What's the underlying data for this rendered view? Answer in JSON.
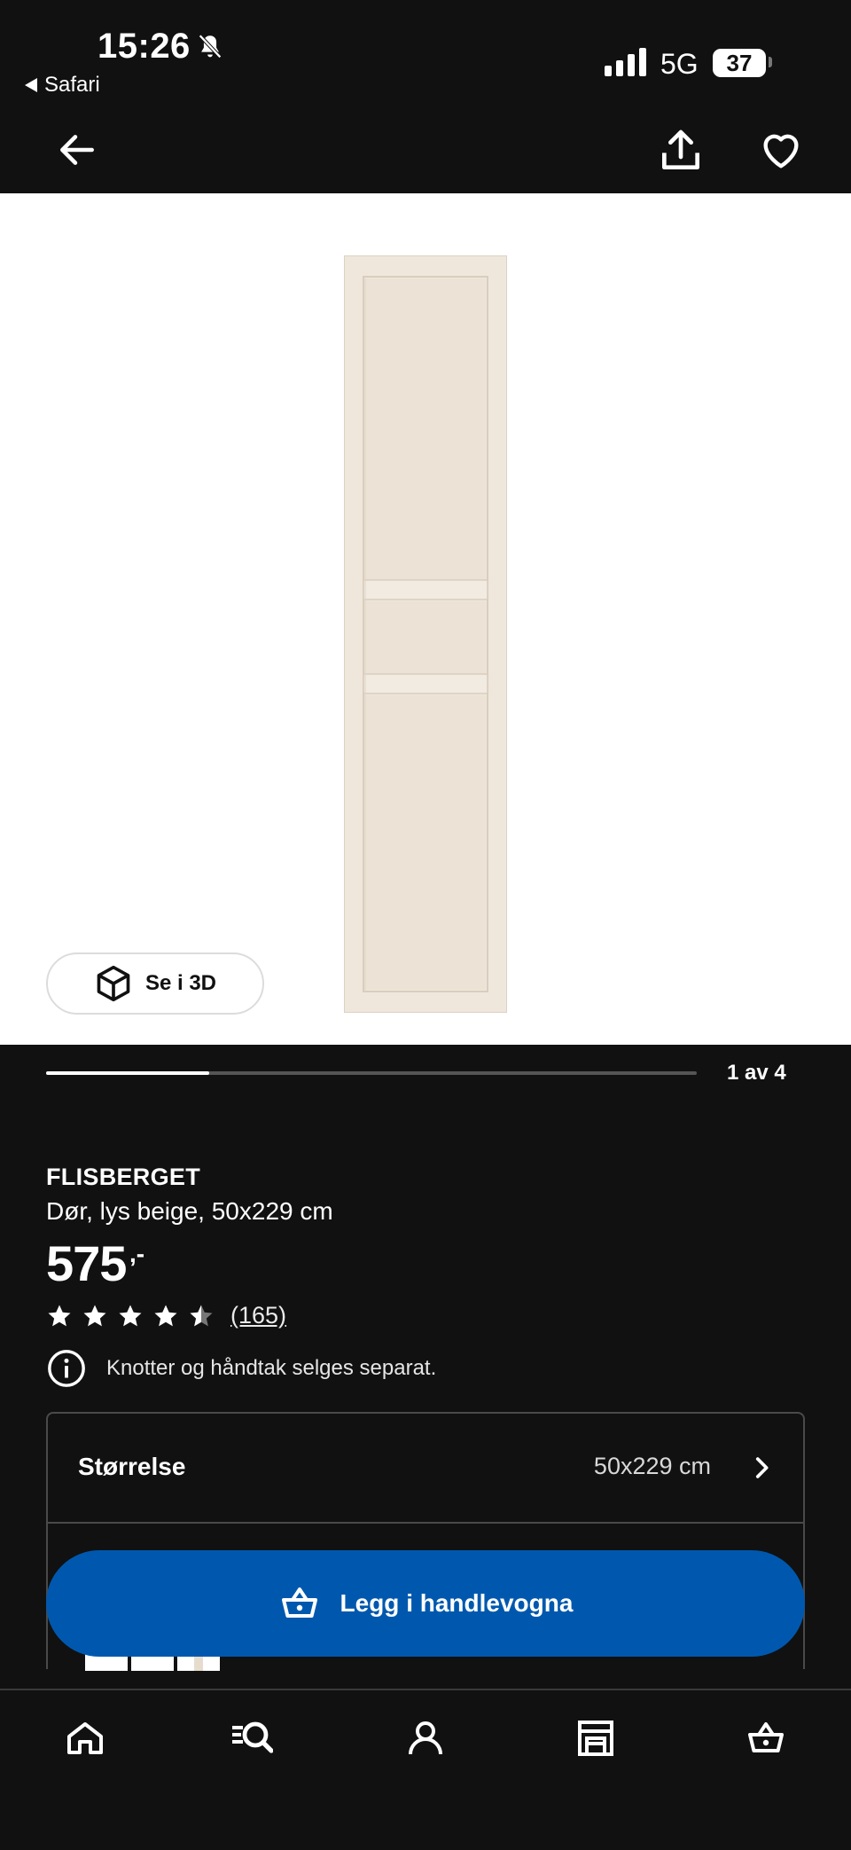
{
  "status_bar": {
    "time": "15:26",
    "back_app": "Safari",
    "network": "5G",
    "battery": "37"
  },
  "top_nav": {
    "back_icon": "arrow-left-icon",
    "share_icon": "share-icon",
    "favorite_icon": "heart-icon"
  },
  "gallery": {
    "view_3d_label": "Se i 3D",
    "image_color": "#efe7dc",
    "progress": 0.25,
    "counter": "1 av 4"
  },
  "product": {
    "name": "FLISBERGET",
    "description": "Dør, lys beige, 50x229 cm",
    "price": "575",
    "price_suffix": ",-",
    "rating": 4.5,
    "rating_count": "(165)",
    "notice": "Knotter og håndtak selges separat."
  },
  "size": {
    "label": "Størrelse",
    "value": "50x229 cm"
  },
  "cart": {
    "label": "Legg i handlevogna",
    "color": "#0058ae"
  },
  "tabs": [
    {
      "icon": "home-icon"
    },
    {
      "icon": "search-list-icon"
    },
    {
      "icon": "profile-icon"
    },
    {
      "icon": "store-icon"
    },
    {
      "icon": "cart-icon"
    }
  ]
}
